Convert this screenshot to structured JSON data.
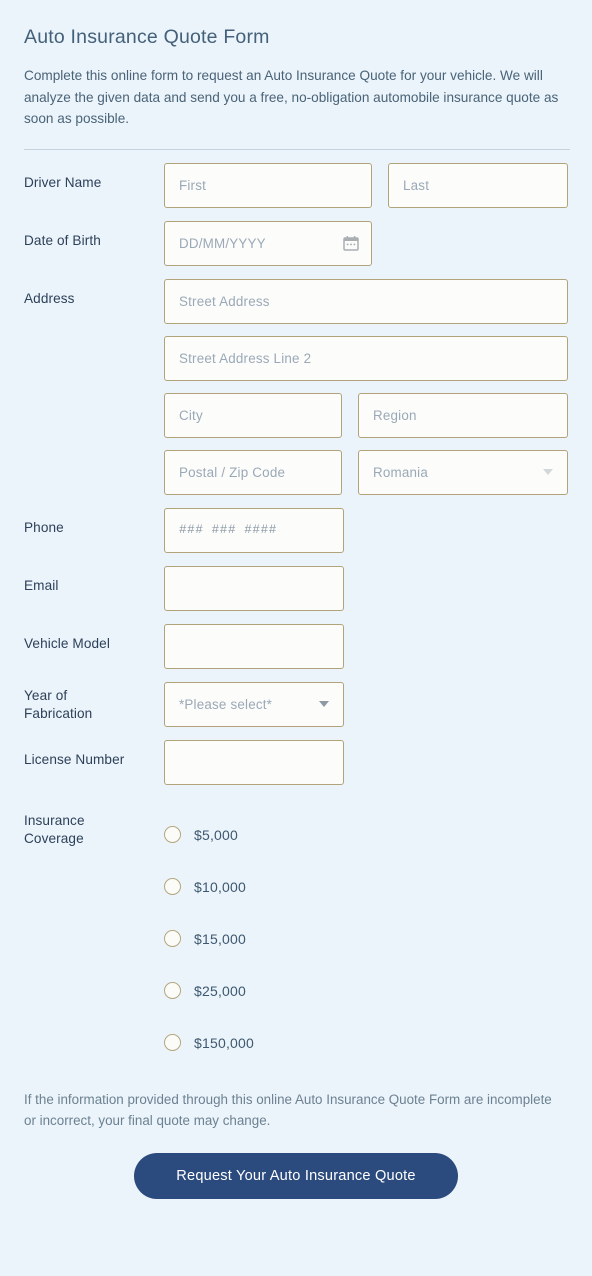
{
  "header": {
    "title": "Auto Insurance Quote Form",
    "description": "Complete this online form to request an Auto Insurance Quote for your vehicle. We will analyze the given data and send you a free, no-obligation automobile insurance quote as soon as possible."
  },
  "fields": {
    "driver_name": {
      "label": "Driver Name",
      "first_placeholder": "First",
      "last_placeholder": "Last"
    },
    "date_of_birth": {
      "label": "Date of Birth",
      "placeholder": "DD/MM/YYYY",
      "icon": "calendar-icon"
    },
    "address": {
      "label": "Address",
      "street_placeholder": "Street Address",
      "street2_placeholder": "Street Address Line 2",
      "city_placeholder": "City",
      "region_placeholder": "Region",
      "postal_placeholder": "Postal / Zip Code",
      "country_value": "Romania"
    },
    "phone": {
      "label": "Phone",
      "placeholder": "### ### ####"
    },
    "email": {
      "label": "Email",
      "value": ""
    },
    "vehicle_model": {
      "label": "Vehicle Model",
      "value": ""
    },
    "year_of_fabrication": {
      "label": "Year of Fabrication",
      "label_line1": "Year of",
      "label_line2": "Fabrication",
      "selected": "*Please select*"
    },
    "license_number": {
      "label": "License Number",
      "value": ""
    },
    "insurance_coverage": {
      "label": "Insurance Coverage",
      "label_line1": "Insurance",
      "label_line2": "Coverage",
      "options": [
        {
          "label": "$5,000",
          "selected": false
        },
        {
          "label": "$10,000",
          "selected": false
        },
        {
          "label": "$15,000",
          "selected": false
        },
        {
          "label": "$25,000",
          "selected": false
        },
        {
          "label": "$150,000",
          "selected": false
        }
      ]
    }
  },
  "footer": {
    "note": "If the information provided through this online Auto Insurance Quote Form are incomplete or incorrect, your final quote may change.",
    "submit_label": "Request Your Auto Insurance Quote"
  },
  "colors": {
    "background": "#eaf4fa",
    "field_border": "#b3a37a",
    "field_fill": "#fcfcfa",
    "label_text": "#2e4059",
    "title_text": "#45607a",
    "button_bg": "#2b4a7d",
    "button_text": "#ffffff",
    "divider": "#c3d2dc"
  }
}
